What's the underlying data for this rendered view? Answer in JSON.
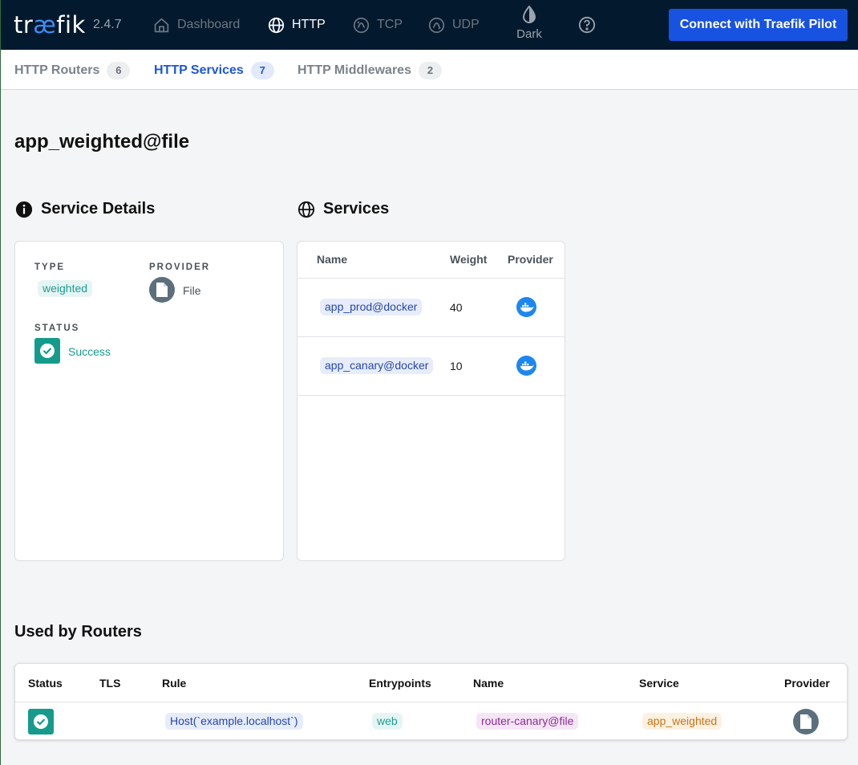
{
  "nav": {
    "logo_prefix": "tr",
    "logo_ae": "æ",
    "logo_suffix": "fik",
    "version": "2.4.7",
    "items": [
      {
        "label": "Dashboard",
        "icon": "home-icon",
        "active": false
      },
      {
        "label": "HTTP",
        "icon": "globe-icon",
        "active": true
      },
      {
        "label": "TCP",
        "icon": "tcp-icon",
        "active": false
      },
      {
        "label": "UDP",
        "icon": "udp-icon",
        "active": false
      }
    ],
    "dark_label": "Dark",
    "help_icon": "help-icon",
    "pilot_button": "Connect with Traefik Pilot"
  },
  "subnav": {
    "tabs": [
      {
        "label": "HTTP Routers",
        "count": "6",
        "active": false
      },
      {
        "label": "HTTP Services",
        "count": "7",
        "active": true
      },
      {
        "label": "HTTP Middlewares",
        "count": "2",
        "active": false
      }
    ]
  },
  "page": {
    "title": "app_weighted@file"
  },
  "details": {
    "section_title": "Service Details",
    "type_label": "TYPE",
    "type_value": "weighted",
    "provider_label": "PROVIDER",
    "provider_value": "File",
    "status_label": "STATUS",
    "status_value": "Success"
  },
  "services": {
    "section_title": "Services",
    "headers": {
      "name": "Name",
      "weight": "Weight",
      "provider": "Provider"
    },
    "rows": [
      {
        "name": "app_prod@docker",
        "weight": "40",
        "provider_icon": "docker-icon"
      },
      {
        "name": "app_canary@docker",
        "weight": "10",
        "provider_icon": "docker-icon"
      }
    ]
  },
  "routers": {
    "section_title": "Used by Routers",
    "headers": {
      "status": "Status",
      "tls": "TLS",
      "rule": "Rule",
      "entrypoints": "Entrypoints",
      "name": "Name",
      "service": "Service",
      "provider": "Provider"
    },
    "rows": [
      {
        "rule": "Host(`example.localhost`)",
        "entrypoints": "web",
        "name": "router-canary@file",
        "service": "app_weighted",
        "provider_icon": "file-icon"
      }
    ]
  },
  "colors": {
    "topbar": "#03192d",
    "accent": "#1852e0",
    "success": "#159b8c",
    "docker": "#1d87f0"
  }
}
